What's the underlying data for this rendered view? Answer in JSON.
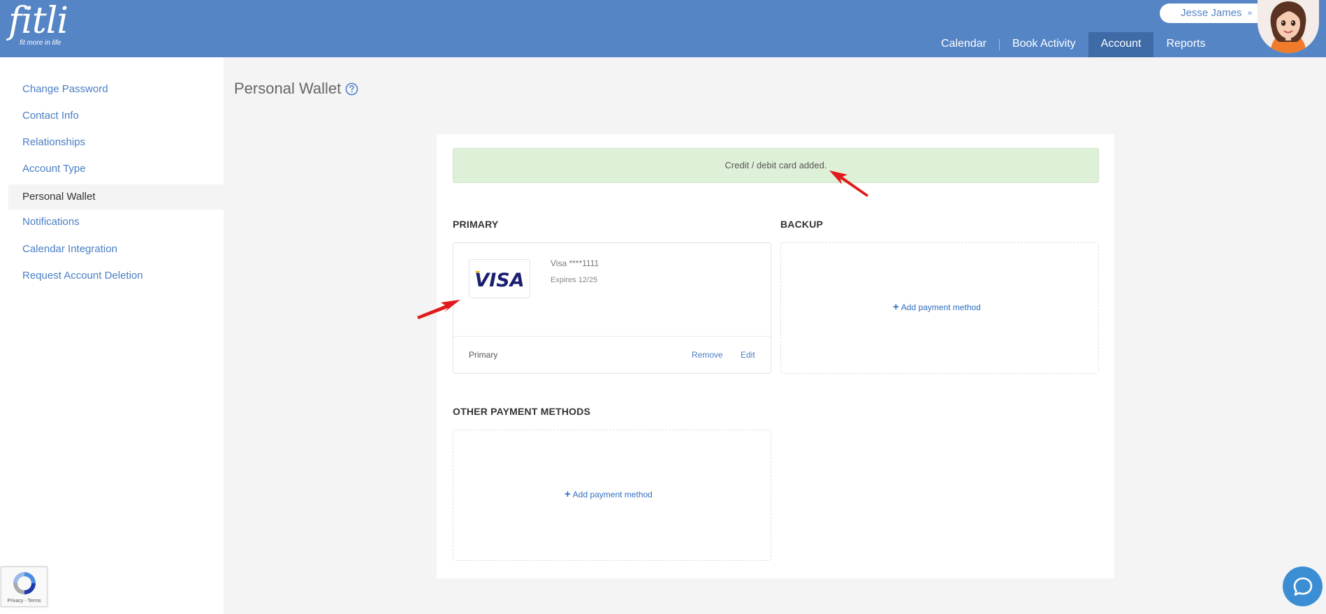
{
  "brand": {
    "name": "fitli",
    "tagline": "fit more in life"
  },
  "user": {
    "name": "Jesse James",
    "chevron": "»"
  },
  "nav": [
    {
      "label": "Calendar"
    },
    {
      "label": "Book Activity"
    },
    {
      "label": "Account",
      "active": true
    },
    {
      "label": "Reports"
    }
  ],
  "sidebar": {
    "items": [
      {
        "label": "Change Password"
      },
      {
        "label": "Contact Info"
      },
      {
        "label": "Relationships"
      },
      {
        "label": "Account Type"
      },
      {
        "label": "Personal Wallet",
        "active": true
      },
      {
        "label": "Notifications"
      },
      {
        "label": "Calendar Integration"
      },
      {
        "label": "Request Account Deletion"
      }
    ]
  },
  "page": {
    "title": "Personal Wallet"
  },
  "alert": {
    "text": "Credit / debit card added."
  },
  "primary": {
    "heading": "PRIMARY",
    "card_brand": "VISA",
    "card_name": "Visa ****1111",
    "expires": "Expires 12/25",
    "label": "Primary",
    "remove_label": "Remove",
    "edit_label": "Edit"
  },
  "backup": {
    "heading": "BACKUP",
    "add_label": "Add payment method"
  },
  "other": {
    "heading": "OTHER PAYMENT METHODS",
    "add_label": "Add payment method"
  },
  "recaptcha": {
    "text": "Privacy - Terms"
  },
  "colors": {
    "header": "#5585c5",
    "nav_active": "#3e6aa6",
    "link": "#4a7fc4",
    "alert_bg": "#dff0d8",
    "visa_blue": "#1a1f71",
    "visa_gold": "#f7b600",
    "arrow": "#e11b1b"
  },
  "icons": [
    "help-circle-icon",
    "plus-icon",
    "chat-icon",
    "recaptcha-icon",
    "red-arrow-icon"
  ]
}
